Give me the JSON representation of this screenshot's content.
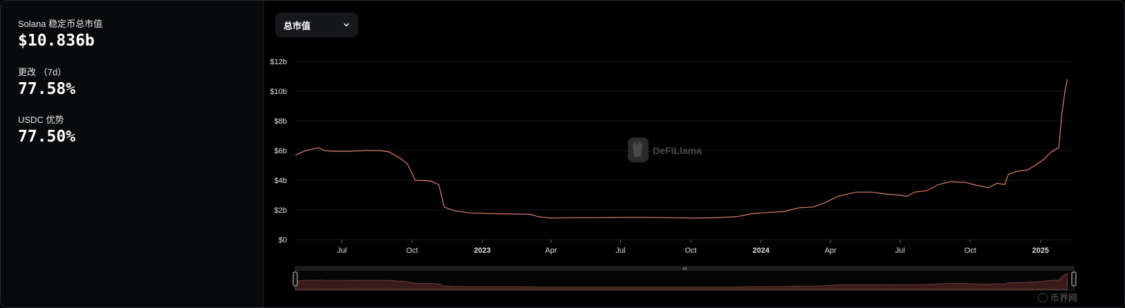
{
  "stats": [
    {
      "label": "Solana 稳定币总市值",
      "value": "$10.836b"
    },
    {
      "label": "更改 （7d）",
      "value": "77.58%"
    },
    {
      "label": "USDC 优势",
      "value": "77.50%"
    }
  ],
  "selector": {
    "label": "总市值"
  },
  "watermark": {
    "text": "DeFiLlama"
  },
  "corner_logo": {
    "text": "币界网"
  },
  "colors": {
    "line": "#e0806f",
    "area": "#3a1a1a",
    "grid": "#1c1c1c"
  },
  "chart_data": {
    "type": "line",
    "yTickLabels": [
      "$0",
      "$2b",
      "$4b",
      "$6b",
      "$8b",
      "$10b",
      "$12b"
    ],
    "yTicks": [
      0,
      2,
      4,
      6,
      8,
      10,
      12
    ],
    "ylim": [
      0,
      12
    ],
    "xlim": [
      "2022-05-01",
      "2025-02-10"
    ],
    "xTicks": [
      {
        "date": "2022-07-01",
        "label": "Jul",
        "bold": false
      },
      {
        "date": "2022-10-01",
        "label": "Oct",
        "bold": false
      },
      {
        "date": "2023-01-01",
        "label": "2023",
        "bold": true
      },
      {
        "date": "2023-04-01",
        "label": "Apr",
        "bold": false
      },
      {
        "date": "2023-07-01",
        "label": "Jul",
        "bold": false
      },
      {
        "date": "2023-10-01",
        "label": "Oct",
        "bold": false
      },
      {
        "date": "2024-01-01",
        "label": "2024",
        "bold": true
      },
      {
        "date": "2024-04-01",
        "label": "Apr",
        "bold": false
      },
      {
        "date": "2024-07-01",
        "label": "Jul",
        "bold": false
      },
      {
        "date": "2024-10-01",
        "label": "Oct",
        "bold": false
      },
      {
        "date": "2025-01-01",
        "label": "2025",
        "bold": true
      }
    ],
    "series": [
      {
        "unit": "billion USD",
        "points": [
          [
            "2022-05-01",
            5.7
          ],
          [
            "2022-05-15",
            6.0
          ],
          [
            "2022-06-01",
            6.2
          ],
          [
            "2022-06-08",
            6.0
          ],
          [
            "2022-06-20",
            5.95
          ],
          [
            "2022-07-10",
            5.95
          ],
          [
            "2022-08-01",
            6.0
          ],
          [
            "2022-08-20",
            6.0
          ],
          [
            "2022-09-01",
            5.9
          ],
          [
            "2022-09-15",
            5.5
          ],
          [
            "2022-09-25",
            5.1
          ],
          [
            "2022-10-05",
            4.0
          ],
          [
            "2022-10-25",
            3.95
          ],
          [
            "2022-11-05",
            3.7
          ],
          [
            "2022-11-12",
            2.2
          ],
          [
            "2022-11-25",
            1.95
          ],
          [
            "2022-12-15",
            1.8
          ],
          [
            "2023-01-15",
            1.75
          ],
          [
            "2023-02-15",
            1.72
          ],
          [
            "2023-03-05",
            1.7
          ],
          [
            "2023-03-15",
            1.55
          ],
          [
            "2023-04-01",
            1.45
          ],
          [
            "2023-05-01",
            1.48
          ],
          [
            "2023-06-01",
            1.48
          ],
          [
            "2023-07-01",
            1.5
          ],
          [
            "2023-08-01",
            1.5
          ],
          [
            "2023-09-01",
            1.48
          ],
          [
            "2023-10-01",
            1.45
          ],
          [
            "2023-11-01",
            1.47
          ],
          [
            "2023-12-01",
            1.55
          ],
          [
            "2023-12-20",
            1.75
          ],
          [
            "2024-01-01",
            1.8
          ],
          [
            "2024-02-01",
            1.9
          ],
          [
            "2024-02-20",
            2.15
          ],
          [
            "2024-03-10",
            2.2
          ],
          [
            "2024-03-25",
            2.5
          ],
          [
            "2024-04-10",
            2.9
          ],
          [
            "2024-04-25",
            3.1
          ],
          [
            "2024-05-05",
            3.2
          ],
          [
            "2024-05-25",
            3.2
          ],
          [
            "2024-06-15",
            3.05
          ],
          [
            "2024-07-01",
            3.0
          ],
          [
            "2024-07-10",
            2.9
          ],
          [
            "2024-07-20",
            3.2
          ],
          [
            "2024-08-05",
            3.3
          ],
          [
            "2024-08-20",
            3.7
          ],
          [
            "2024-09-05",
            3.9
          ],
          [
            "2024-09-25",
            3.85
          ],
          [
            "2024-10-10",
            3.65
          ],
          [
            "2024-10-25",
            3.5
          ],
          [
            "2024-11-05",
            3.8
          ],
          [
            "2024-11-15",
            3.7
          ],
          [
            "2024-11-20",
            4.4
          ],
          [
            "2024-12-01",
            4.6
          ],
          [
            "2024-12-15",
            4.7
          ],
          [
            "2024-12-25",
            5.0
          ],
          [
            "2025-01-05",
            5.4
          ],
          [
            "2025-01-15",
            5.9
          ],
          [
            "2025-01-25",
            6.2
          ],
          [
            "2025-01-29",
            8.5
          ],
          [
            "2025-02-02",
            10.0
          ],
          [
            "2025-02-05",
            10.8
          ]
        ]
      }
    ]
  }
}
